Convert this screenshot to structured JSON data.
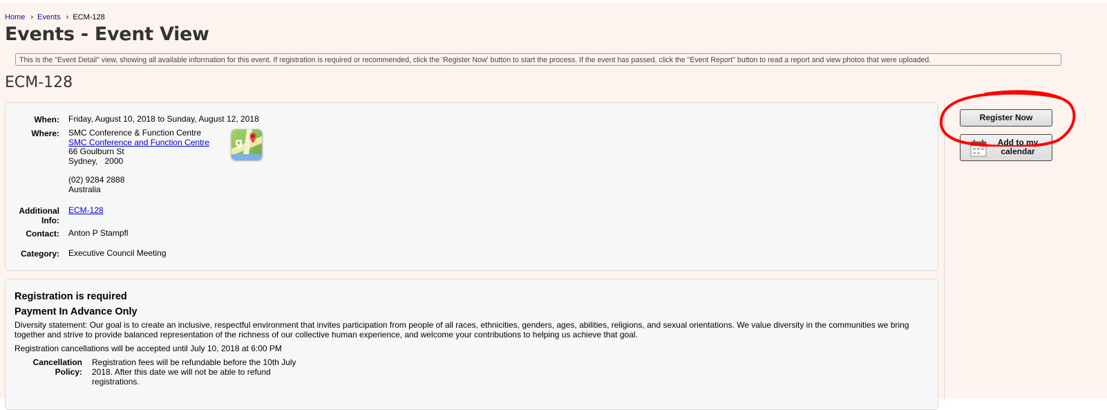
{
  "breadcrumb": {
    "home": "Home",
    "events": "Events",
    "current": "ECM-128",
    "separator": "›"
  },
  "page_title": "Events - Event View",
  "info_text": "This is the \"Event Detail\" view, showing all available information for this event. If registration is required or recommended, click the 'Register Now' button to start the process. If the event has passed, click the \"Event Report\" button to read a report and view photos that were uploaded.",
  "event": {
    "title": "ECM-128",
    "labels": {
      "when": "When:",
      "where": "Where:",
      "additional": "Additional Info:",
      "contact": "Contact:",
      "category": "Category:"
    },
    "when": "Friday, August 10, 2018 to Sunday, August 12, 2018",
    "where": {
      "venue": "SMC Conference & Function Centre",
      "venue_link": "SMC Conference and Function Centre",
      "street": "66 Goulburn St",
      "city_postcode": "Sydney,   2000",
      "phone": "(02) 9284 2888",
      "country": "Australia"
    },
    "additional_info": "ECM-128",
    "contact": "Anton P Stampfl",
    "category": "Executive Council Meeting"
  },
  "registration": {
    "heading": "Registration is required",
    "payment": "Payment In Advance Only",
    "diversity": "Diversity statement: Our goal is to create an inclusive, respectful environment that invites participation from people of all races, ethnicities, genders, ages, abilities, religions, and sexual orientations. We value diversity in the communities we bring together and strive to provide balanced representation of the richness of our collective human experience, and welcome your contributions to helping us achieve that goal.",
    "cancellation_line": "Registration cancellations will be accepted until July 10, 2018 at 6:00 PM",
    "cancellation_policy_label": "Cancellation Policy:",
    "cancellation_policy_text": "Registration fees will be refundable before the 10th July 2018. After this date we will not be able to refund registrations."
  },
  "sidebar": {
    "register_label": "Register Now",
    "calendar_label": "Add to my calendar"
  },
  "colors": {
    "link": "#1a0dab",
    "page_bg": "#fef4ef",
    "annotation": "#ff0000"
  }
}
